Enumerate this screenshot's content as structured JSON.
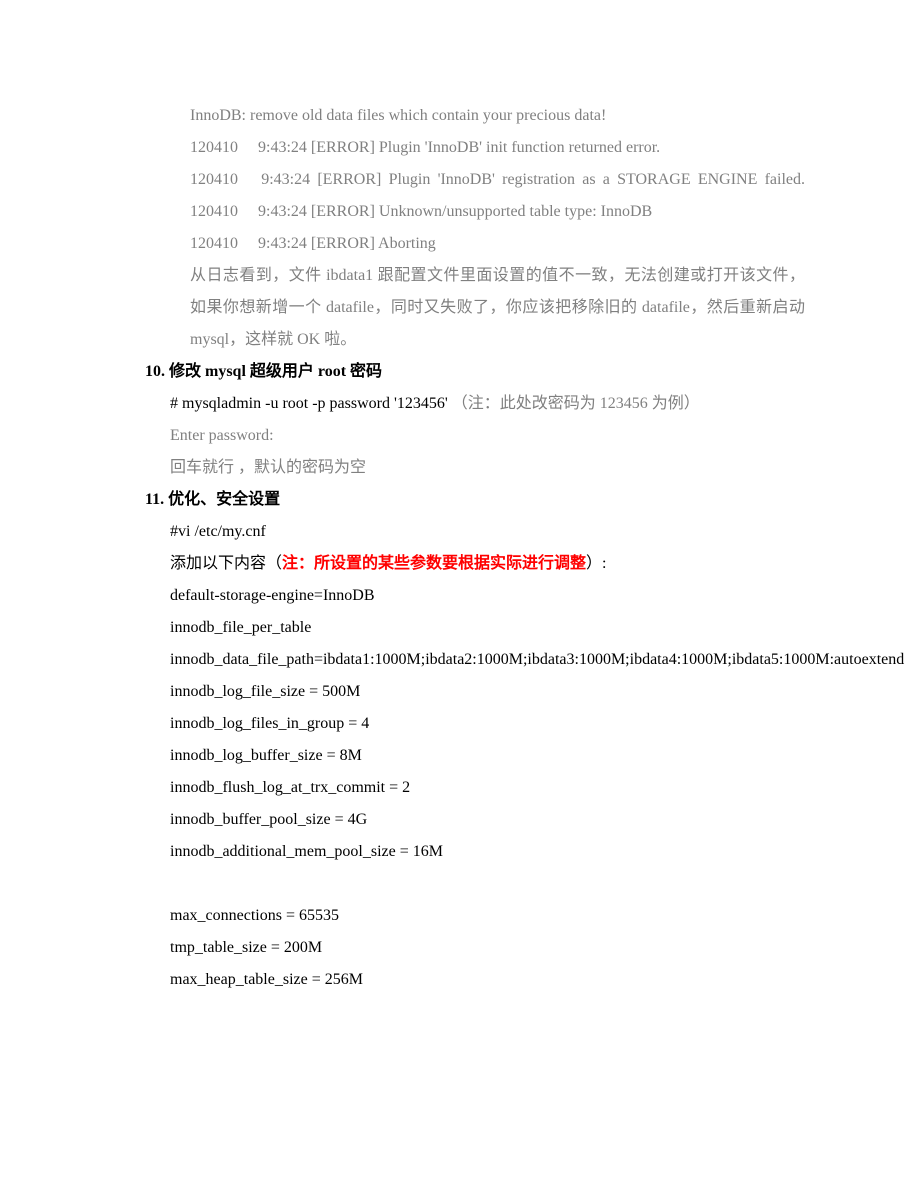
{
  "log": {
    "l1": "InnoDB: remove old data files which contain your precious data!",
    "l2": "120410  9:43:24 [ERROR] Plugin 'InnoDB' init function returned error.",
    "l3": "120410   9:43:24  [ERROR]  Plugin  'InnoDB'  registration  as  a  STORAGE ENGINE failed.",
    "l4": "120410  9:43:24 [ERROR] Unknown/unsupported table type: InnoDB",
    "l5": "120410  9:43:24 [ERROR] Aborting",
    "note": "从日志看到，文件 ibdata1 跟配置文件里面设置的值不一致，无法创建或打开该文件，如果你想新增一个 datafile，同时又失败了，你应该把移除旧的 datafile，然后重新启动 mysql，这样就 OK 啦。"
  },
  "sec10": {
    "heading": "10. 修改 mysql 超级用户 root 密码",
    "cmd_black": "# mysqladmin -u root -p password '123456' ",
    "cmd_gray": "（注：此处改密码为 123456 为例）",
    "prompt": "Enter password:",
    "note": "回车就行 ，默认的密码为空"
  },
  "sec11": {
    "heading": "11. 优化、安全设置",
    "cmd": "#vi /etc/my.cnf",
    "pre_black": "添加以下内容（",
    "pre_red": "注：所设置的某些参数要根据实际进行调整",
    "post_black": "）:",
    "cfg": {
      "c1": "default-storage-engine=InnoDB",
      "c2": "innodb_file_per_table",
      "c3": "innodb_data_file_path=ibdata1:1000M;ibdata2:1000M;ibdata3:1000M;ibdata4:1000M;ibdata5:1000M:autoextend",
      "c4": "innodb_log_file_size = 500M",
      "c5": "innodb_log_files_in_group = 4",
      "c6": "innodb_log_buffer_size = 8M",
      "c7": "innodb_flush_log_at_trx_commit = 2",
      "c8": "innodb_buffer_pool_size = 4G",
      "c9": "innodb_additional_mem_pool_size = 16M",
      "c10": "max_connections = 65535",
      "c11": "tmp_table_size = 200M",
      "c12": "max_heap_table_size = 256M"
    }
  }
}
